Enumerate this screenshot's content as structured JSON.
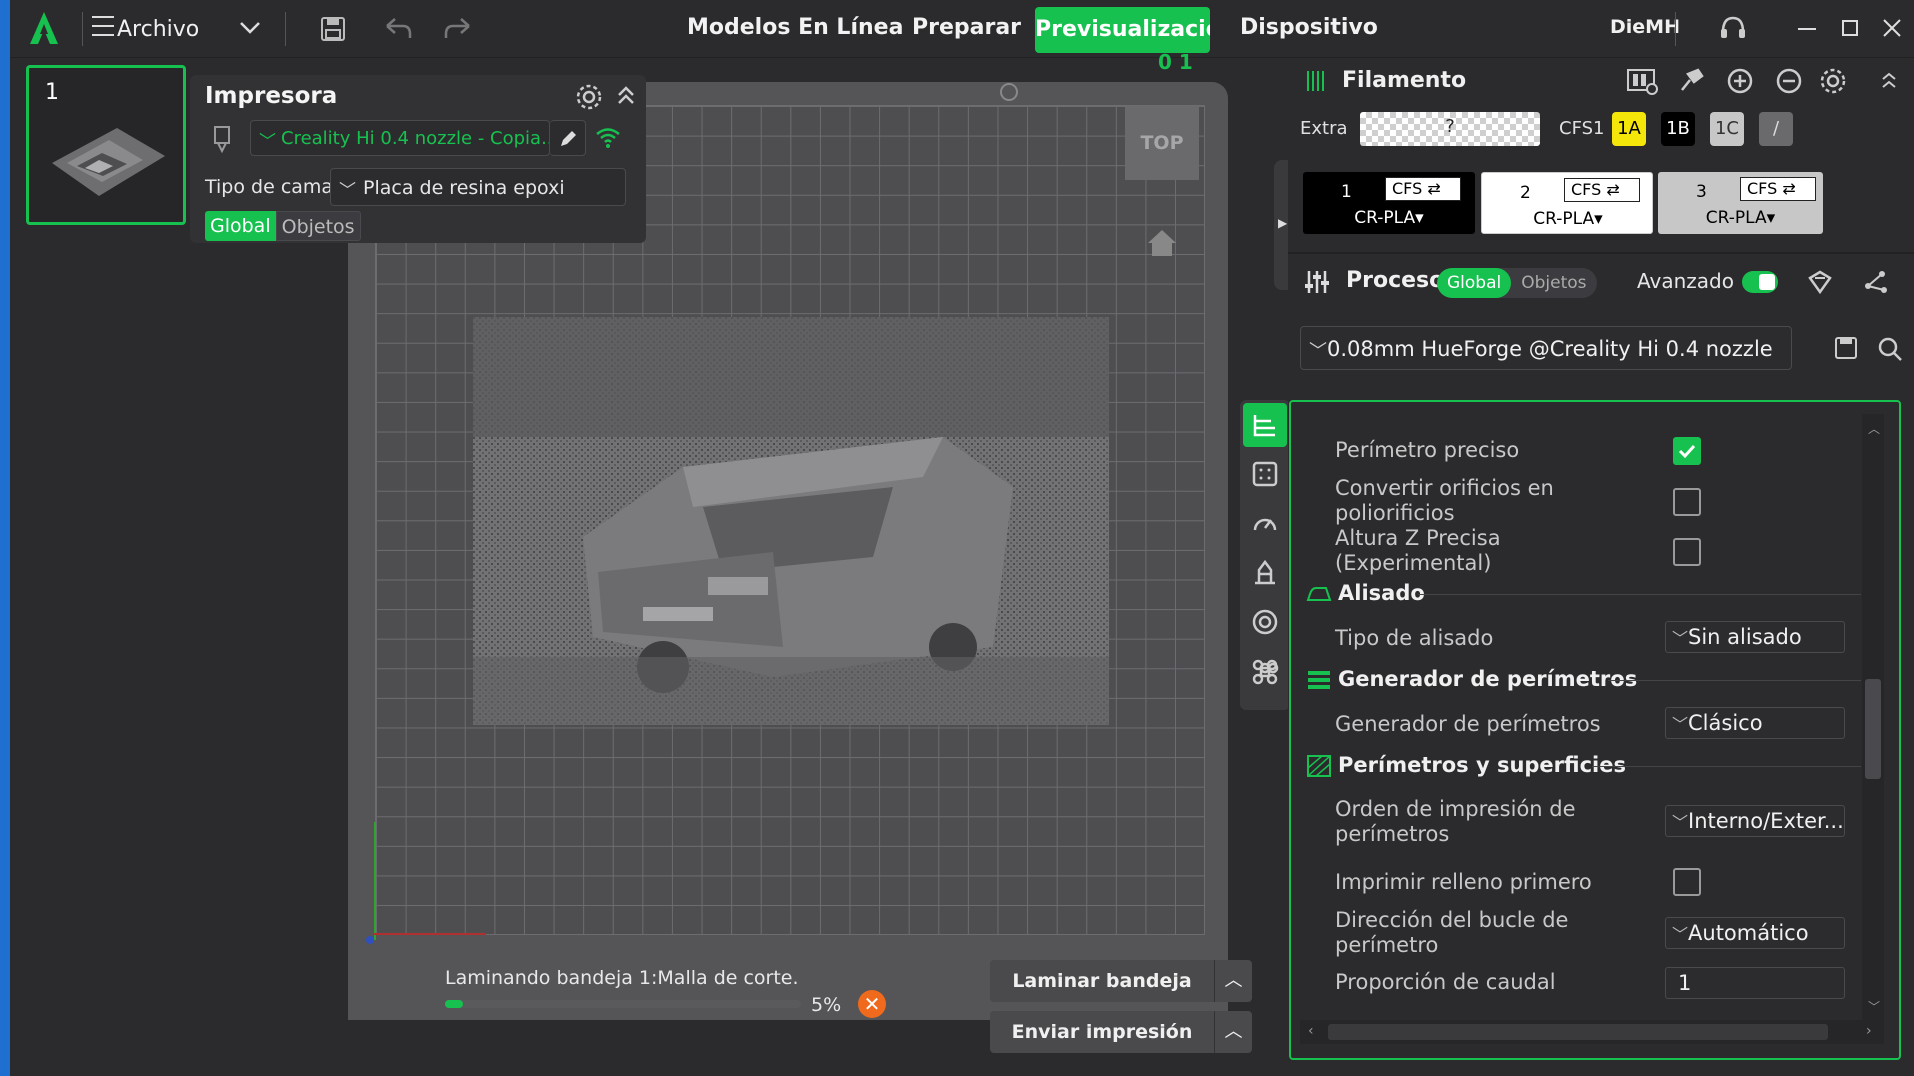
{
  "menubar": {
    "file_label": "Archivo",
    "tabs": [
      "Modelos En Línea",
      "Preparar",
      "Previsualización",
      "Dispositivo"
    ],
    "user": "DieMH",
    "icons": [
      "creality-logo-icon",
      "hamburger-menu-icon",
      "chevron-down-icon",
      "save-icon",
      "undo-icon",
      "redo-icon",
      "support-icon",
      "minimize-icon",
      "maximize-icon",
      "close-icon"
    ]
  },
  "plate": {
    "number": "1"
  },
  "printer": {
    "title": "Impresora",
    "printer_name": "Creality Hi 0.4 nozzle - Copia..",
    "bed_label": "Tipo de cama",
    "bed_value": "Placa de resina epoxi",
    "toggle_global": "Global",
    "toggle_objects": "Objetos"
  },
  "viewport": {
    "view_button": "TOP"
  },
  "status": {
    "text": "Laminando bandeja 1:Malla de corte.",
    "percent_label": "5%",
    "progress": 0.05
  },
  "actions": {
    "slice": "Laminar bandeja",
    "send": "Enviar impresión"
  },
  "filament": {
    "title": "Filamento",
    "extra_label": "Extra",
    "extra_value": "?",
    "cfs_label": "CFS1",
    "slots": [
      {
        "label": "1A",
        "bg": "#f5e60a",
        "fg": "#000000"
      },
      {
        "label": "1B",
        "bg": "#000000",
        "fg": "#ffffff"
      },
      {
        "label": "1C",
        "bg": "#c7c7c7",
        "fg": "#333333"
      },
      {
        "label": "/",
        "bg": "#6a6a6d",
        "fg": "#dddddd"
      }
    ],
    "cards": [
      {
        "num": "1",
        "tag": "CFS ⇄",
        "name": "CR-PLA▾",
        "bg": "#000000",
        "fg": "#ffffff"
      },
      {
        "num": "2",
        "tag": "CFS ⇄",
        "name": "CR-PLA▾",
        "bg": "#ffffff",
        "fg": "#000000"
      },
      {
        "num": "3",
        "tag": "CFS ⇄",
        "name": "CR-PLA▾",
        "bg": "#c7c7c7",
        "fg": "#000000"
      }
    ]
  },
  "process": {
    "title": "Proceso",
    "toggle_global": "Global",
    "toggle_objects": "Objetos",
    "advanced_label": "Avanzado",
    "advanced_on": true,
    "profile": "0.08mm HueForge @Creality Hi 0.4 nozzle"
  },
  "settings": {
    "precise_wall": {
      "label": "Perímetro preciso",
      "checked": true
    },
    "convert_holes": {
      "label": "Convertir orificios en poliorificios",
      "checked": false
    },
    "precise_z": {
      "label": "Altura Z Precisa (Experimental)",
      "checked": false
    },
    "ironing_group": "Alisado",
    "ironing_type_label": "Tipo de alisado",
    "ironing_type_value": "Sin alisado",
    "wall_gen_group": "Generador de perímetros",
    "wall_gen_label": "Generador de perímetros",
    "wall_gen_value": "Clásico",
    "walls_surfaces_group": "Perímetros y superficies",
    "wall_order_label": "Orden de impresión de perímetros",
    "wall_order_value": "Interno/Exter...",
    "infill_first": {
      "label": "Imprimir relleno primero",
      "checked": false
    },
    "wall_direction_label": "Dirección del bucle de perímetro",
    "wall_direction_value": "Automático",
    "flow_ratio_label": "Proporción de caudal",
    "flow_ratio_value": "1"
  },
  "colors": {
    "accent": "#17c14f",
    "background": "#2b2b2e",
    "cancel": "#f06a1d"
  }
}
